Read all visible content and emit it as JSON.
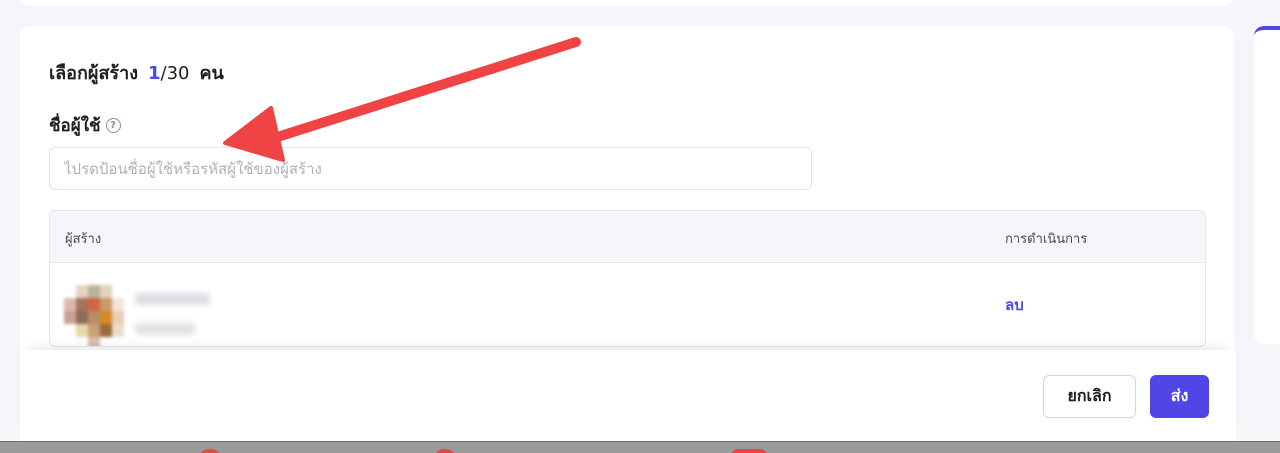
{
  "heading": {
    "title": "เลือกผู้สร้าง",
    "selected": "1",
    "max": "/30",
    "unit": "คน"
  },
  "field": {
    "label": "ชื่อผู้ใช้",
    "help_icon": "?",
    "placeholder": "ไปรดป้อนชื่อผู้ใช้หรือรหัสผู้ใช้ของผู้สร้าง",
    "value": ""
  },
  "table": {
    "columns": [
      "ผู้สร้าง",
      "การดำเนินการ"
    ],
    "rows": [
      {
        "creator": "",
        "action": "ลบ"
      }
    ]
  },
  "footer": {
    "cancel_label": "ยกเลิก",
    "send_label": "ส่ง"
  },
  "colors": {
    "accent": "#4f46e5",
    "annotation_arrow": "#f04444"
  },
  "icons": [
    "help-icon",
    "annotation-arrow-icon"
  ]
}
